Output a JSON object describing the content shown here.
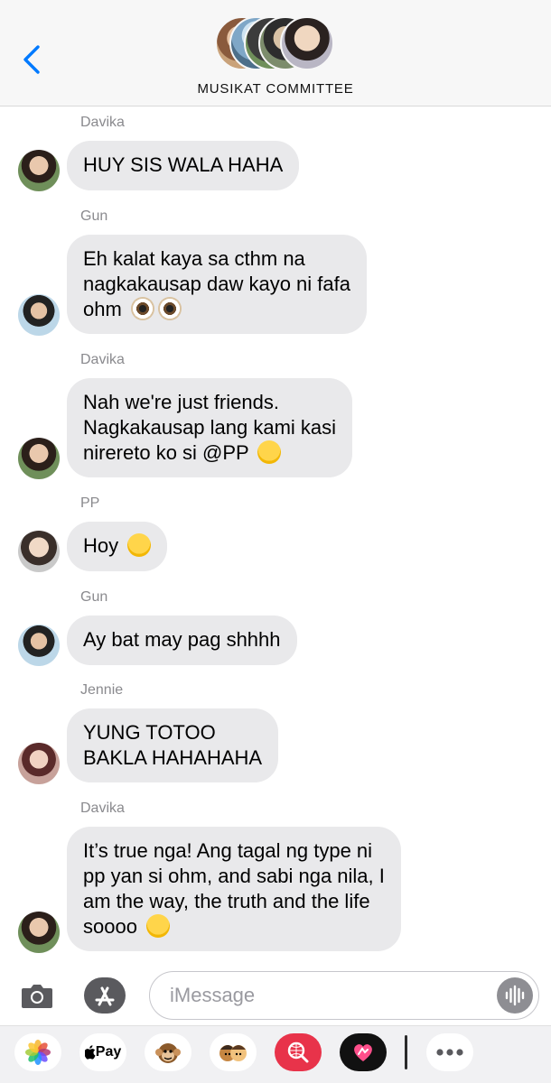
{
  "header": {
    "group_name": "MUSIKAT COMMITTEE"
  },
  "messages": [
    {
      "sender": "Davika",
      "lines": [
        "HUY SIS WALA HAHA"
      ]
    },
    {
      "sender": "Gun",
      "lines": [
        "Eh kalat kaya sa cthm na",
        "nagkakausap daw kayo ni fafa",
        "ohm"
      ],
      "emoji": [
        "eyes-emoji",
        "eyes-emoji"
      ]
    },
    {
      "sender": "Davika",
      "lines": [
        "Nah we're just friends.",
        "Nagkakausap lang kami kasi",
        "nirereto ko si @PP"
      ],
      "emoji": [
        "zany-face-emoji"
      ]
    },
    {
      "sender": "PP",
      "lines": [
        "Hoy"
      ],
      "emoji": [
        "shushing-face-emoji"
      ]
    },
    {
      "sender": "Gun",
      "lines": [
        "Ay bat may pag shhhh"
      ]
    },
    {
      "sender": "Jennie",
      "lines": [
        "YUNG TOTOO",
        "BAKLA HAHAHAHA"
      ]
    },
    {
      "sender": "Davika",
      "lines": [
        "It’s true nga! Ang tagal ng type ni",
        "pp yan si ohm, and sabi nga nila, I",
        "am the way, the truth and the life",
        "soooo"
      ],
      "emoji": [
        "relieved-face-emoji"
      ]
    }
  ],
  "input": {
    "placeholder": "iMessage"
  },
  "drawer": {
    "apple_pay_label": "Pay"
  },
  "icons": {
    "back": "chevron-left-icon",
    "camera": "camera-icon",
    "appstore": "app-store-icon",
    "mic": "audio-waveform-icon",
    "more": "more-dots-icon"
  },
  "colors": {
    "accent": "#007aff",
    "bubble": "#e9e9eb",
    "sender_name": "#8a8a8e"
  }
}
